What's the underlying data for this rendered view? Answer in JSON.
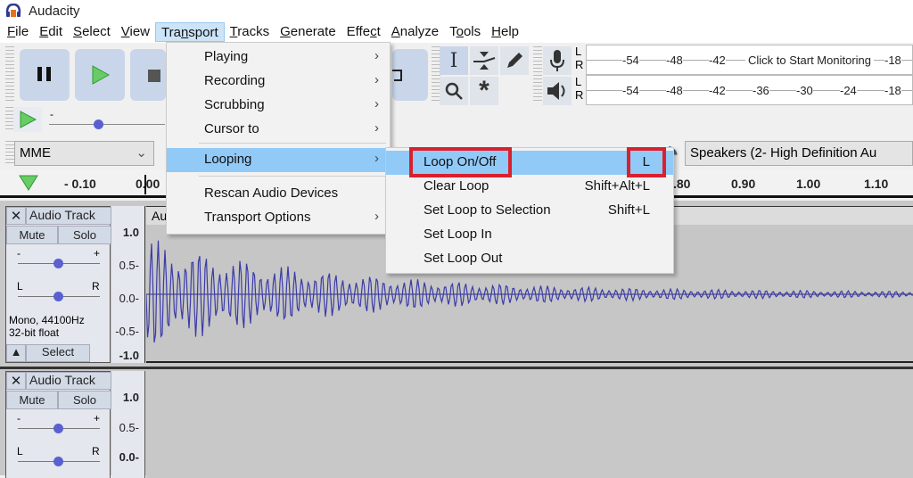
{
  "window": {
    "title": "Audacity"
  },
  "menubar": {
    "items": [
      {
        "label": "File",
        "ul": "F",
        "rest": "ile"
      },
      {
        "label": "Edit",
        "ul": "E",
        "rest": "dit"
      },
      {
        "label": "Select",
        "ul": "S",
        "rest": "elect"
      },
      {
        "label": "View",
        "ul": "V",
        "rest": "iew"
      },
      {
        "label": "Transport",
        "pre": "Tra",
        "ul": "n",
        "rest": "sport",
        "active": true
      },
      {
        "label": "Tracks",
        "ul": "T",
        "rest": "racks"
      },
      {
        "label": "Generate",
        "ul": "G",
        "rest": "enerate"
      },
      {
        "label": "Effect",
        "pre": "Effe",
        "ul": "c",
        "rest": "t"
      },
      {
        "label": "Analyze",
        "ul": "A",
        "rest": "nalyze"
      },
      {
        "label": "Tools",
        "pre": "T",
        "ul": "o",
        "rest": "ols"
      },
      {
        "label": "Help",
        "ul": "H",
        "rest": "elp"
      }
    ]
  },
  "toolbar": {
    "host": "MME",
    "playback_device": "Speakers (2- High Definition Au",
    "record_meter": {
      "ticks": [
        "-54",
        "-48",
        "-42",
        "-18"
      ],
      "prompt": "Click to Start Monitoring",
      "channels": [
        "L",
        "R"
      ]
    },
    "play_meter": {
      "ticks": [
        "-54",
        "-48",
        "-42",
        "-36",
        "-30",
        "-24",
        "-18"
      ],
      "channels": [
        "L",
        "R"
      ]
    }
  },
  "ruler": {
    "ticks": [
      "- 0.10",
      "0.00",
      ".80",
      "0.90",
      "1.00",
      "1.10"
    ]
  },
  "transport_menu": {
    "items": [
      {
        "label": "Playing",
        "submenu": true
      },
      {
        "label": "Recording",
        "submenu": true
      },
      {
        "label": "Scrubbing",
        "submenu": true
      },
      {
        "label": "Cursor to",
        "submenu": true
      },
      {
        "label": "Looping",
        "submenu": true,
        "highlighted": true
      },
      {
        "label": "Rescan Audio Devices",
        "submenu": false
      },
      {
        "label": "Transport Options",
        "submenu": true
      }
    ]
  },
  "looping_submenu": {
    "items": [
      {
        "label": "Loop On/Off",
        "shortcut": "L",
        "highlighted": true
      },
      {
        "label": "Clear Loop",
        "shortcut": "Shift+Alt+L"
      },
      {
        "label": "Set Loop to Selection",
        "shortcut": "Shift+L"
      },
      {
        "label": "Set Loop In",
        "shortcut": ""
      },
      {
        "label": "Set Loop Out",
        "shortcut": ""
      }
    ]
  },
  "tracks": [
    {
      "name": "Audio Track",
      "mute": "Mute",
      "solo": "Solo",
      "gain_minus": "-",
      "gain_plus": "+",
      "pan_left": "L",
      "pan_right": "R",
      "info_line1": "Mono, 44100Hz",
      "info_line2": "32-bit float",
      "select": "Select",
      "clip_label": "Au",
      "scale": [
        "1.0",
        "0.5-",
        "0.0-",
        "-0.5-",
        "-1.0"
      ]
    },
    {
      "name": "Audio Track",
      "mute": "Mute",
      "solo": "Solo",
      "gain_minus": "-",
      "gain_plus": "+",
      "pan_left": "L",
      "pan_right": "R",
      "scale": [
        "1.0",
        "0.5-",
        "0.0-"
      ]
    }
  ],
  "colors": {
    "highlight": "#91c9f7",
    "annotation": "#d9202f",
    "waveform": "#3b3ba8"
  }
}
